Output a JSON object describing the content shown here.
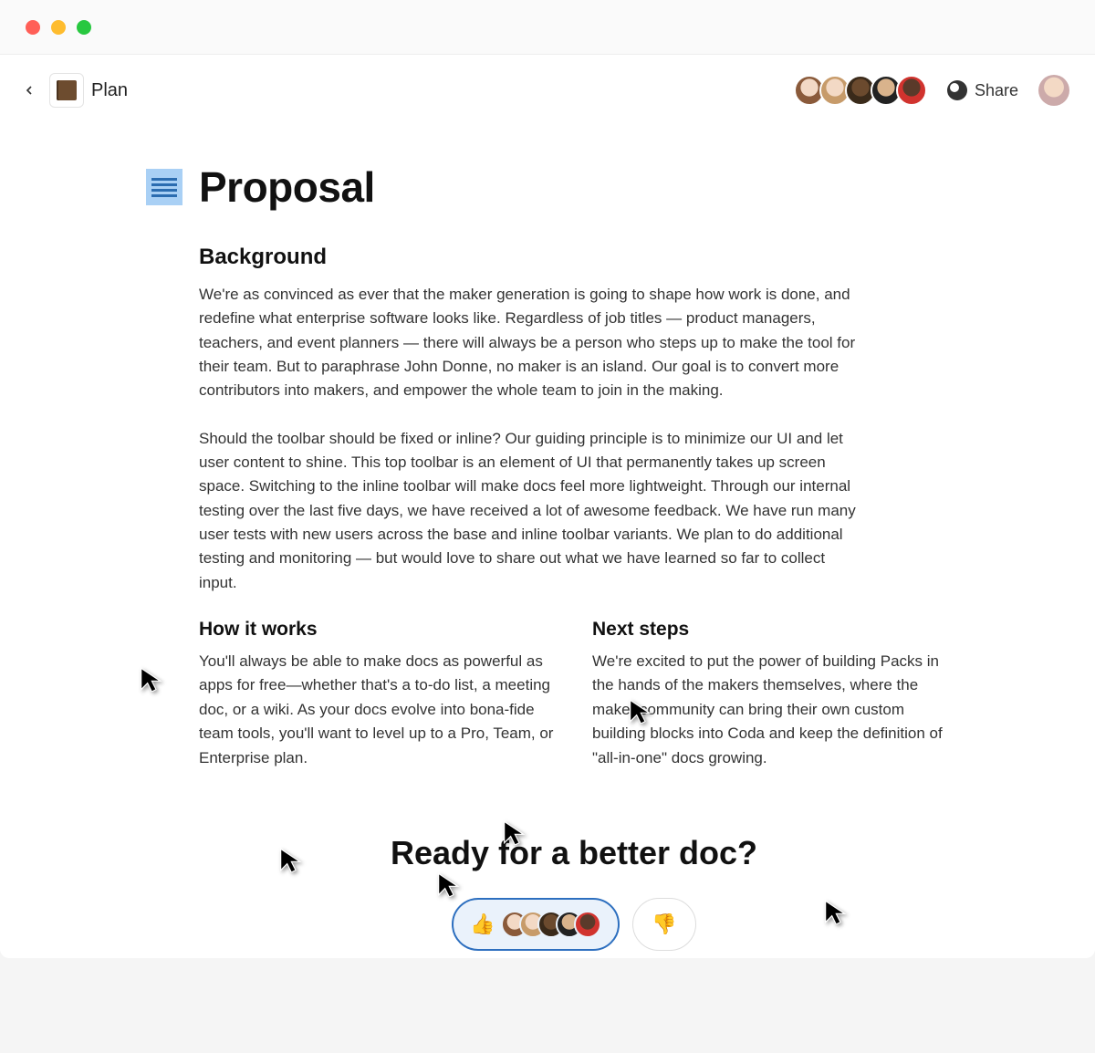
{
  "window": {
    "doc_name": "Plan"
  },
  "header": {
    "share_label": "Share",
    "collaborators": [
      "user-1",
      "user-2",
      "user-3",
      "user-4",
      "user-5"
    ]
  },
  "page": {
    "title": "Proposal",
    "background_heading": "Background",
    "background_p1": "We're as convinced as ever that the maker generation is going to shape how work is done, and redefine what enterprise software looks like. Regardless of job titles — product managers, teachers, and event planners — there will always be a person who steps up to make the tool for their team. But to paraphrase John Donne, no maker is an island. Our goal is to convert more contributors into makers, and empower the whole team to join in the making.",
    "background_p2": "Should the toolbar should be fixed or inline? Our guiding principle is to minimize our UI and let user content to shine. This top toolbar is an element of UI that permanently takes up screen space. Switching to the inline toolbar will make docs feel more lightweight. Through our internal testing over the last five days, we have received a lot of awesome feedback. We have run many user tests with new users across the base and inline toolbar variants. We plan to do additional testing and monitoring — but would love to share out what we have learned so far to collect input.",
    "how_heading": "How it works",
    "how_body": "You'll always be able to make docs as powerful as apps for free—whether that's a to-do list, a meeting doc, or a wiki. As your docs evolve into bona-fide team tools, you'll want to level up to a Pro, Team, or Enterprise plan.",
    "next_heading": "Next steps",
    "next_body": "We're excited to put the power of building Packs in the hands of the makers themselves, where the maker community can bring their own custom building blocks into Coda and keep the definition of \"all-in-one\" docs growing."
  },
  "cta": {
    "heading": "Ready for a better doc?",
    "thumbs_up_icon": "👍",
    "thumbs_down_icon": "👎",
    "up_voters": [
      "a",
      "b",
      "c",
      "d",
      "e"
    ]
  }
}
